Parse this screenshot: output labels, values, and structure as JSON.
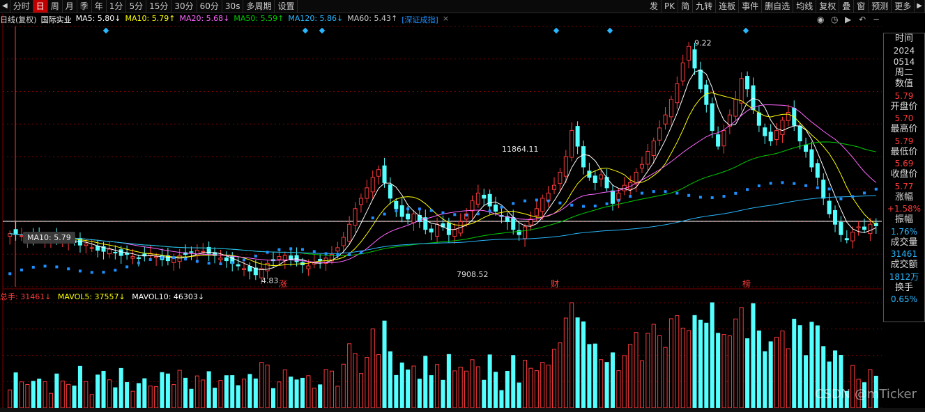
{
  "toolbar": {
    "left": [
      "分时",
      "日",
      "周",
      "月",
      "季",
      "年",
      "1分",
      "5分",
      "15分",
      "30分",
      "60分",
      "30s",
      "多周期",
      "设置"
    ],
    "active_index": 1,
    "right": [
      "发",
      "PK",
      "简",
      "九转",
      "连板",
      "事件",
      "删自选",
      "均线",
      "复权",
      "叠",
      "窗",
      "预测",
      "更多"
    ]
  },
  "legend": {
    "period": "日线(复权)",
    "name": "国际实业",
    "ma5": "MA5: 5.80↓",
    "ma10": "MA10: 5.79↑",
    "ma20": "MA20: 5.68↓",
    "ma50": "MA50: 5.59↑",
    "ma120": "MA120: 5.86↓",
    "ma60": "MA60: 5.43↑",
    "index": "[深证成指]",
    "close": "×"
  },
  "colors": {
    "up": "#ff3b3b",
    "down": "#54ffff",
    "ma5": "#ffffff",
    "ma10": "#ffff00",
    "ma20": "#ff66ff",
    "ma50": "#00cc00",
    "ma120": "#29b8ff",
    "ma60": "#cccccc",
    "index": "#1e90ff",
    "grid": "#7a0000"
  },
  "annotations": {
    "high": "9.22",
    "low": "4.83",
    "index_high": "11864.11",
    "index_low": "7908.52",
    "tooltip": "MA10: 5.79",
    "markers": [
      "涨",
      "财",
      "榜"
    ]
  },
  "volume_legend": {
    "total": "总手: 31461↓",
    "mavol5": "MAVOL5: 37557↓",
    "mavol10": "MAVOL10: 46303↓"
  },
  "sidepanel": [
    {
      "label": "时间",
      "value": "2024"
    },
    {
      "label": "",
      "value": "0514"
    },
    {
      "label": "周二",
      "value": ""
    },
    {
      "label": "数值",
      "value": "5.79"
    },
    {
      "label": "开盘价",
      "value": "5.70"
    },
    {
      "label": "最高价",
      "value": "5.79"
    },
    {
      "label": "最低价",
      "value": "5.69"
    },
    {
      "label": "收盘价",
      "value": "5.77"
    },
    {
      "label": "涨幅",
      "value": "+1.58%"
    },
    {
      "label": "振幅",
      "value": "1.76%"
    },
    {
      "label": "成交量",
      "value": "31461"
    },
    {
      "label": "成交额",
      "value": "1812万"
    },
    {
      "label": "换手",
      "value": "0.65%"
    }
  ],
  "watermark": "CSDN @mTicker",
  "chart_data": {
    "type": "candlestick",
    "ylim": [
      4.6,
      9.6
    ],
    "grid": true,
    "close": [
      5.62,
      5.6,
      5.58,
      5.55,
      5.52,
      5.56,
      5.53,
      5.5,
      5.48,
      5.52,
      5.49,
      5.45,
      5.4,
      5.42,
      5.35,
      5.3,
      5.28,
      5.32,
      5.25,
      5.2,
      5.22,
      5.18,
      5.15,
      5.2,
      5.24,
      5.18,
      5.12,
      5.1,
      5.15,
      5.2,
      5.22,
      5.26,
      5.3,
      5.28,
      5.24,
      5.2,
      5.15,
      5.1,
      5.05,
      5.0,
      4.95,
      4.9,
      4.83,
      4.95,
      5.05,
      5.1,
      5.18,
      5.2,
      5.12,
      5.08,
      5.02,
      5.0,
      5.06,
      5.1,
      5.15,
      5.22,
      5.35,
      5.55,
      5.8,
      6.1,
      6.3,
      6.5,
      6.7,
      6.85,
      6.6,
      6.3,
      6.1,
      5.95,
      5.9,
      6.0,
      5.85,
      5.7,
      5.65,
      5.8,
      5.75,
      5.6,
      5.7,
      5.85,
      6.0,
      6.25,
      6.4,
      6.3,
      6.15,
      6.05,
      5.95,
      5.85,
      5.7,
      5.6,
      5.75,
      5.9,
      6.1,
      6.3,
      6.4,
      6.55,
      6.8,
      7.1,
      7.6,
      7.3,
      6.9,
      6.7,
      6.6,
      6.75,
      6.5,
      6.2,
      6.4,
      6.55,
      6.6,
      6.8,
      6.95,
      7.2,
      7.4,
      7.65,
      7.9,
      8.2,
      8.5,
      8.9,
      9.22,
      8.8,
      8.4,
      8.1,
      7.6,
      7.3,
      7.6,
      7.9,
      8.2,
      8.6,
      8.4,
      8.0,
      7.7,
      7.5,
      7.4,
      7.6,
      7.8,
      7.95,
      7.7,
      7.4,
      7.2,
      6.9,
      6.7,
      6.3,
      6.0,
      5.8,
      5.6,
      5.5,
      5.65,
      5.75,
      5.7,
      5.8,
      5.77
    ]
  }
}
